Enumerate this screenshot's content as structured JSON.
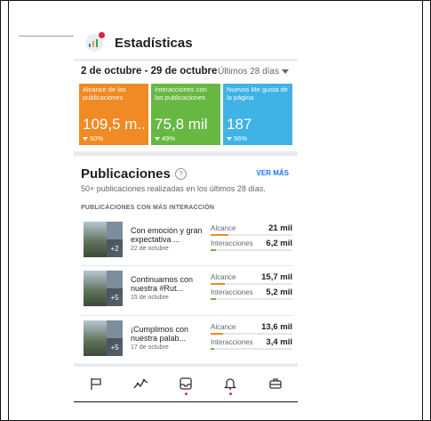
{
  "header": {
    "title": "Estadísticas"
  },
  "summary": {
    "date_range": "2 de octubre - 29 de octubre",
    "period_label": "Últimos 28 días"
  },
  "cards": [
    {
      "label": "Alcance de las publicaciones",
      "value": "109,5 m..",
      "change": "50%",
      "color": "#f08a24"
    },
    {
      "label": "Interacciones con las publicaciones",
      "value": "75,8 mil",
      "change": "49%",
      "color": "#67b843"
    },
    {
      "label": "Nuevos Me gusta de la página",
      "value": "187",
      "change": "56%",
      "color": "#3fb3e6"
    }
  ],
  "publications": {
    "title": "Publicaciones",
    "help_icon": "?",
    "see_more": "VER MÁS",
    "subtitle": "50+ publicaciones realizadas en los últimos 28 días.",
    "section_label": "PUBLICACIONES CON MÁS INTERACCIÓN",
    "posts": [
      {
        "text": "Con emoción y gran expectativa ...",
        "date": "22 de octubre",
        "thumb_count": "+2",
        "reach_label": "Alcance",
        "reach_value": "21 mil",
        "reach_fraction": 0.22,
        "inter_label": "Interacciones",
        "inter_value": "6,2 mil",
        "inter_fraction": 0.07
      },
      {
        "text": "Continuamos con nuestra #Rut...",
        "date": "15 de octubre",
        "thumb_count": "+5",
        "reach_label": "Alcance",
        "reach_value": "15,7 mil",
        "reach_fraction": 0.17,
        "inter_label": "Interacciones",
        "inter_value": "5,2 mil",
        "inter_fraction": 0.06
      },
      {
        "text": "¡Cumplimos con nuestra palab...",
        "date": "17 de octubre",
        "thumb_count": "+5",
        "reach_label": "Alcance",
        "reach_value": "13,6 mil",
        "reach_fraction": 0.15,
        "inter_label": "Interacciones",
        "inter_value": "3,4 mil",
        "inter_fraction": 0.04
      }
    ]
  },
  "nav": [
    {
      "icon": "flag-icon"
    },
    {
      "icon": "activity-icon"
    },
    {
      "icon": "inbox-icon",
      "badge": true
    },
    {
      "icon": "bell-icon",
      "badge": true
    },
    {
      "icon": "briefcase-icon"
    }
  ],
  "colors": {
    "accent": "#1877f2",
    "reach_bar": "#f08a24",
    "inter_bar": "#67b843",
    "badge": "#f02849"
  }
}
